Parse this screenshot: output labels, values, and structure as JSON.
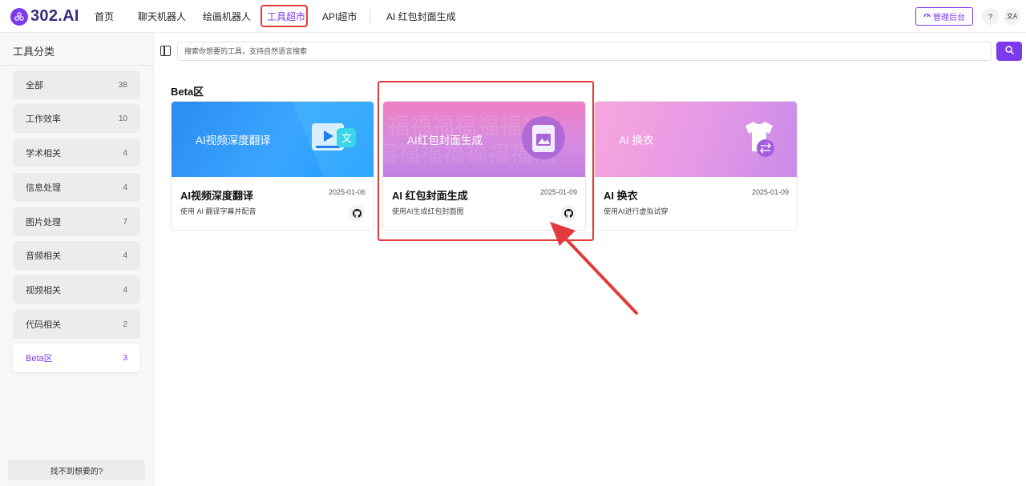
{
  "header": {
    "logo_text": "302.AI",
    "nav": [
      "首页",
      "聊天机器人",
      "绘画机器人",
      "工具超市",
      "API超市",
      "AI 红包封面生成"
    ],
    "active_nav": "工具超市",
    "admin_label": "管理后台",
    "help_icon": "?",
    "lang_icon": "文A"
  },
  "sidebar": {
    "title": "工具分类",
    "categories": [
      {
        "label": "全部",
        "count": "38"
      },
      {
        "label": "工作效率",
        "count": "10"
      },
      {
        "label": "学术相关",
        "count": "4"
      },
      {
        "label": "信息处理",
        "count": "4"
      },
      {
        "label": "图片处理",
        "count": "7"
      },
      {
        "label": "音频相关",
        "count": "4"
      },
      {
        "label": "视频相关",
        "count": "4"
      },
      {
        "label": "代码相关",
        "count": "2"
      },
      {
        "label": "Beta区",
        "count": "3"
      }
    ],
    "active_category": "Beta区",
    "help_label": "找不到想要的?"
  },
  "search": {
    "placeholder": "搜索你想要的工具，支持自然语言搜索"
  },
  "main": {
    "section_title": "Beta区",
    "cards": [
      {
        "banner_text": "AI视频深度翻译",
        "title": "AI视频深度翻译",
        "date": "2025-01-06",
        "desc": "使用 AI 翻译字幕并配音"
      },
      {
        "banner_text": "AI红包封面生成",
        "title": "AI 红包封面生成",
        "date": "2025-01-09",
        "desc": "使用AI生成红包封面图"
      },
      {
        "banner_text": "AI 换衣",
        "title": "AI 换衣",
        "date": "2025-01-09",
        "desc": "使用AI进行虚拟试穿"
      }
    ]
  },
  "colors": {
    "accent": "#7c3aed",
    "annotation_red": "#e23b3b"
  }
}
